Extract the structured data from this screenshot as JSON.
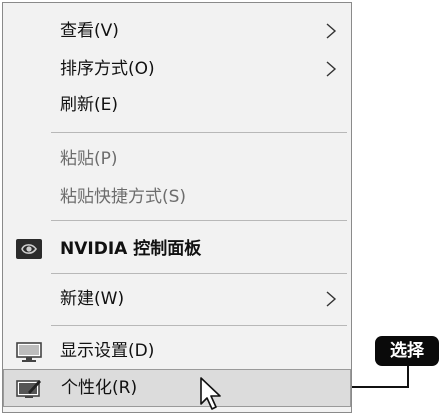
{
  "context_menu": {
    "items": [
      {
        "label": "查看(V)",
        "has_submenu": true
      },
      {
        "label": "排序方式(O)",
        "has_submenu": true
      },
      {
        "label": "刷新(E)"
      },
      {
        "label": "粘贴(P)",
        "disabled": true
      },
      {
        "label": "粘贴快捷方式(S)",
        "disabled": true
      },
      {
        "label": "NVIDIA 控制面板",
        "icon": "nvidia-icon"
      },
      {
        "label": "新建(W)",
        "has_submenu": true
      },
      {
        "label": "显示设置(D)",
        "icon": "display-settings-icon"
      },
      {
        "label": "个性化(R)",
        "icon": "personalize-icon",
        "selected": true
      }
    ]
  },
  "callout": {
    "label": "选择"
  },
  "colors": {
    "menu_bg": "#f2f2f2",
    "selected_bg": "#dcdcdc",
    "callout_bg": "#0a0a0a"
  }
}
